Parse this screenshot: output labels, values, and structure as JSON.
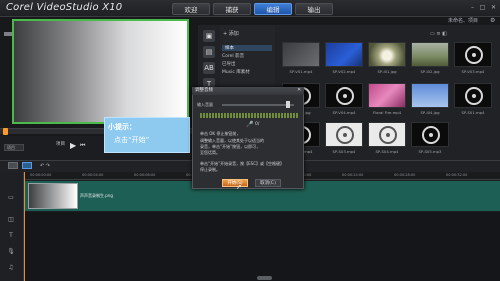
{
  "app": {
    "title": "Corel VideoStudio X10",
    "project_name": "未命名、项目"
  },
  "tabs": [
    {
      "label": "欢迎",
      "active": false
    },
    {
      "label": "捕获",
      "active": false
    },
    {
      "label": "编辑",
      "active": true
    },
    {
      "label": "输出",
      "active": false
    }
  ],
  "window_controls": {
    "minimize": "–",
    "maximize": "□",
    "close": "✕"
  },
  "library": {
    "add_label": "+ 添加",
    "items": [
      "样本",
      "Corel 影音",
      "已导出",
      "Music 库素材"
    ]
  },
  "thumbnails": [
    {
      "label": "SP-V01.mp4",
      "style": "gray"
    },
    {
      "label": "SP-V02.mp4",
      "style": "blue"
    },
    {
      "label": "SP-I01.jpg",
      "style": "flower"
    },
    {
      "label": "SP-I02.jpg",
      "style": "field"
    },
    {
      "label": "SP-V03.mp4",
      "style": "dark"
    },
    {
      "label": "SP-I03.jpg",
      "style": "dark"
    },
    {
      "label": "SP-V04.mp4",
      "style": "dark"
    },
    {
      "label": "Floral Fire.mp4",
      "style": "pink"
    },
    {
      "label": "SP-I04.jpg",
      "style": "bluesky"
    },
    {
      "label": "SP-S01.mp4",
      "style": "dark"
    },
    {
      "label": "SP-S02.mp4",
      "style": "dark"
    },
    {
      "label": "SP-S03.mp4",
      "style": "white-disc"
    },
    {
      "label": "SP-S04.mp4",
      "style": "white-disc"
    },
    {
      "label": "SP-S05.mp3",
      "style": "dark"
    }
  ],
  "playback": {
    "mode": "项目",
    "project_label": "项目",
    "play": "▶",
    "rewind": "⏮"
  },
  "callout": {
    "title": "小提示：",
    "body": "点击“开始”"
  },
  "dialog": {
    "title": "调整音频",
    "close": "✕",
    "input_label": "输入音量",
    "mic_value": "0/",
    "lines": [
      "单击 OK 停止按钮前，",
      "调整输入音量，以使其处于以适当的",
      "录音，单击“开始”按钮，以即可，",
      "至您话筒。",
      "",
      "单击“开始”开始录音，按【ESC】或【空格键】",
      "停止录制。"
    ],
    "start": "开始(S)",
    "cancel": "取消(C)"
  },
  "timeline": {
    "ticks": [
      "00:00:00:00",
      "00:00:04:00",
      "00:00:08:00",
      "00:00:12:00",
      "00:00:16:00",
      "00:00:20:00",
      "00:00:24:00",
      "00:00:28:00",
      "00:00:32:00"
    ],
    "clip_name": "声声音录制生.png",
    "track_label": "全部"
  },
  "colors": {
    "accent_tab": "#2f6ac4",
    "preview_border": "#4bb94c",
    "video_track": "#1d5f54",
    "callout": "#8ec9ef",
    "start_button": "#e08836",
    "playhead": "#e58d33"
  }
}
